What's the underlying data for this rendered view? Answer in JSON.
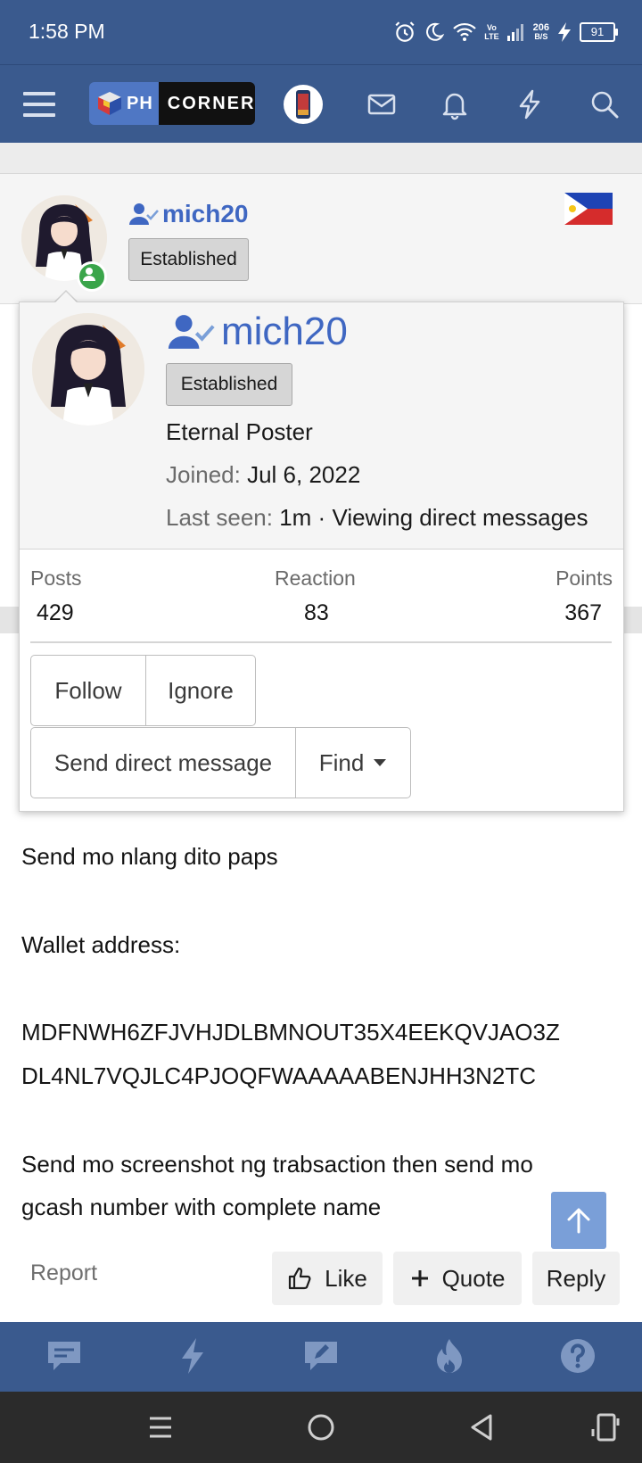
{
  "status_bar": {
    "time": "1:58 PM",
    "network_top": "Vo",
    "network_bottom": "LTE",
    "speed_top": "206",
    "speed_bottom": "B/S",
    "battery": "91"
  },
  "header": {
    "logo_left": "PH",
    "logo_right": "CORNER"
  },
  "post": {
    "username": "mich20",
    "badge": "Established"
  },
  "tooltip": {
    "username": "mich20",
    "badge": "Established",
    "title": "Eternal Poster",
    "joined_label": "Joined:",
    "joined_value": "Jul 6, 2022",
    "last_seen_label": "Last seen:",
    "last_seen_value": "1m · Viewing direct messages",
    "stats": {
      "posts_label": "Posts",
      "posts_value": "429",
      "reaction_label": "Reaction",
      "reaction_value": "83",
      "points_label": "Points",
      "points_value": "367"
    },
    "buttons": {
      "follow": "Follow",
      "ignore": "Ignore",
      "send_dm": "Send direct message",
      "find": "Find"
    }
  },
  "content": {
    "line1": "Send mo nlang dito paps",
    "line2": "Wallet address:",
    "line3": "MDFNWH6ZFJVHJDLBMNOUT35X4EEKQVJAO3Z",
    "line4": "DL4NL7VQJLC4PJOQFWAAAAABENJHH3N2TC",
    "line5": "Send mo screenshot ng trabsaction then send mo",
    "line6": "gcash number with complete name"
  },
  "actions": {
    "report": "Report",
    "like": "Like",
    "quote": "Quote",
    "reply": "Reply"
  },
  "colors": {
    "header_bg": "#3a5a8e",
    "username": "#3f67c2",
    "online": "#3aa54a",
    "scroll_top": "#7a9fd8"
  },
  "icons": [
    "menu-icon",
    "envelope-icon",
    "bell-icon",
    "bolt-icon",
    "search-icon",
    "user-check-icon",
    "chevron-down-icon",
    "arrow-up-icon",
    "thumbs-up-icon",
    "plus-icon",
    "chat-icon",
    "edit-icon",
    "fire-icon",
    "question-icon"
  ]
}
